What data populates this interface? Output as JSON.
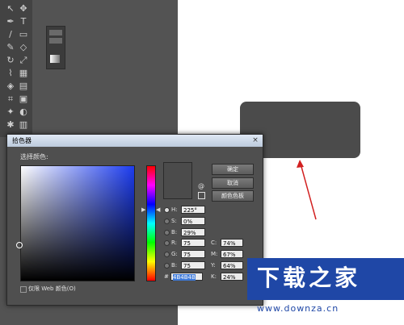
{
  "tools": [
    {
      "glyph": "↖",
      "icon": "selection-tool-icon"
    },
    {
      "glyph": "✥",
      "icon": "lasso-tool-icon"
    },
    {
      "glyph": "✒",
      "icon": "pen-tool-icon"
    },
    {
      "glyph": "T",
      "icon": "type-tool-icon"
    },
    {
      "glyph": "/",
      "icon": "line-tool-icon"
    },
    {
      "glyph": "▭",
      "icon": "rectangle-tool-icon"
    },
    {
      "glyph": "✎",
      "icon": "pencil-tool-icon"
    },
    {
      "glyph": "◇",
      "icon": "eraser-tool-icon"
    },
    {
      "glyph": "↻",
      "icon": "rotate-tool-icon"
    },
    {
      "glyph": "⤢",
      "icon": "scale-tool-icon"
    },
    {
      "glyph": "⌇",
      "icon": "warp-tool-icon"
    },
    {
      "glyph": "▦",
      "icon": "free-transform-tool-icon"
    },
    {
      "glyph": "◈",
      "icon": "shape-builder-tool-icon"
    },
    {
      "glyph": "▤",
      "icon": "perspective-grid-tool-icon"
    },
    {
      "glyph": "⌗",
      "icon": "mesh-tool-icon"
    },
    {
      "glyph": "▣",
      "icon": "gradient-tool-icon"
    },
    {
      "glyph": "✦",
      "icon": "eyedropper-tool-icon"
    },
    {
      "glyph": "◐",
      "icon": "blend-tool-icon"
    },
    {
      "glyph": "✱",
      "icon": "symbol-sprayer-tool-icon"
    },
    {
      "glyph": "▥",
      "icon": "graph-tool-icon"
    }
  ],
  "dialog": {
    "title": "拾色器",
    "close": "×",
    "select_label": "选择颜色:",
    "buttons": {
      "ok": "确定",
      "cancel": "取消",
      "swatches": "颜色色板"
    },
    "hsb": [
      {
        "label": "H:",
        "value": "225°",
        "selected": true
      },
      {
        "label": "S:",
        "value": "0%",
        "selected": false
      },
      {
        "label": "B:",
        "value": "29%",
        "selected": false
      }
    ],
    "rgb": [
      {
        "label": "R:",
        "value": "75"
      },
      {
        "label": "G:",
        "value": "75"
      },
      {
        "label": "B:",
        "value": "75"
      }
    ],
    "cmyk": [
      {
        "label": "C:",
        "value": "74%"
      },
      {
        "label": "M:",
        "value": "67%"
      },
      {
        "label": "Y:",
        "value": "64%"
      },
      {
        "label": "K:",
        "value": "24%"
      }
    ],
    "hex_label": "#",
    "hex_value": "4B4B4B",
    "web_only_label": "仅限 Web 颜色(O)",
    "current_color": "#4b4b4b"
  },
  "watermark": {
    "text": "下载之家",
    "url": "www.downza.cn"
  },
  "colors": {
    "shape_fill": "#4b4b4b",
    "arrow": "#d22020",
    "watermark_bg": "#1f47a6"
  }
}
